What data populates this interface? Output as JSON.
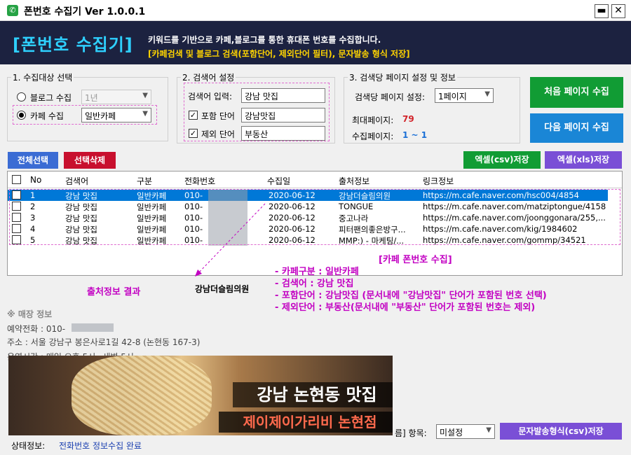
{
  "window": {
    "title": "폰번호 수집기  Ver 1.0.0.1",
    "minimize": "▬",
    "close": "✕"
  },
  "banner": {
    "logo": "[폰번호 수집기]",
    "desc": "키워드를 기반으로 카페,블로그를 통한 휴대폰 번호를 수집합니다.",
    "sub": "[카페검색 및 블로그 검색(포함단어, 제외단어 필터), 문자발송 형식 저장]"
  },
  "target": {
    "label": "1. 수집대상 선택",
    "blog_label": "블로그 수집",
    "blog_value": "1년",
    "cafe_label": "카페 수집",
    "cafe_value": "일반카페"
  },
  "search": {
    "label": "2. 검색어 설정",
    "keyword_label": "검색어 입력:",
    "keyword_value": "강남 맛집",
    "include_label": "포함 단어",
    "include_value": "강남맛집",
    "exclude_label": "제외 단어",
    "exclude_value": "부동산"
  },
  "pages": {
    "label": "3. 검색당 페이지 설정 및 정보",
    "per_search_label": "검색당 페이지 설정:",
    "per_search_value": "1페이지",
    "max_label": "최대페이지:",
    "max_value": "79",
    "collected_label": "수집페이지:",
    "collected_value": "1 ~ 1"
  },
  "buttons": {
    "first_page": "처음 페이지 수집",
    "next_page": "다음 페이지 수집",
    "select_all": "전체선택",
    "delete_selected": "선택삭제",
    "excel_csv": "엑셀(csv)저장",
    "excel_xls": "엑셀(xls)저장",
    "sms_csv": "문자발송형식(csv)저장"
  },
  "table": {
    "headers": [
      "No",
      "검색어",
      "구분",
      "전화번호",
      "수집일",
      "출처정보",
      "링크정보"
    ],
    "rows": [
      {
        "no": "1",
        "keyword": "강남 맛집",
        "type": "일반카페",
        "phone": "010-",
        "date": "2020-06-12",
        "source": "강남더슬림의원",
        "link": "https://m.cafe.naver.com/hsc004/4854"
      },
      {
        "no": "2",
        "keyword": "강남 맛집",
        "type": "일반카페",
        "phone": "010-",
        "date": "2020-06-12",
        "source": "TONGUE",
        "link": "https://m.cafe.naver.com/matziptongue/4158"
      },
      {
        "no": "3",
        "keyword": "강남 맛집",
        "type": "일반카페",
        "phone": "010-",
        "date": "2020-06-12",
        "source": "중고나라",
        "link": "https://m.cafe.naver.com/joonggonara/255,..."
      },
      {
        "no": "4",
        "keyword": "강남 맛집",
        "type": "일반카페",
        "phone": "010-",
        "date": "2020-06-12",
        "source": "피터팬의좋은방구...",
        "link": "https://m.cafe.naver.com/kig/1984602"
      },
      {
        "no": "5",
        "keyword": "강남 맛집",
        "type": "일반카페",
        "phone": "010-",
        "date": "2020-06-12",
        "source": "MMP:) - 마케팅/...",
        "link": "https://m.cafe.naver.com/gommp/34521"
      }
    ]
  },
  "annotation": {
    "title": "[카페 폰번호 수집]",
    "lines": [
      "- 카페구분 : 일반카페",
      "- 검색어 : 강남 맛집",
      "- 포함단어 : 강남맛집 (문서내에 \"강남맛집\" 단어가 포함된 번호 선택)",
      "- 제외단어 : 부동산(문서내에 \"부동산\" 단어가 포함된 번호는 제외)"
    ],
    "source_result": "출처정보 결과",
    "source_name": "강남더슬림의원"
  },
  "store": {
    "heading": "※ 매장 정보",
    "phone": "예약전화 : 010-",
    "address": "주소 : 서울 강남구 봉은사로1길 42-8 (논현동 167-3)",
    "hours": "운영시간 : 매일 오후 5시~새벽 5시",
    "photo_caption1": "강남 논현동 맛집",
    "photo_caption2": "제이제이가리비 논현점"
  },
  "footer": {
    "item_label": "름] 항목:",
    "item_value": "미설정",
    "status_label": "상태정보:",
    "status_value": "전화번호 정보수집 완료"
  },
  "colors": {
    "banner_bg": "#1c2240",
    "logo": "#2ed0ff",
    "sub": "#ffd400",
    "green_btn": "#119c34",
    "blue_btn": "#1a86d6",
    "purple_btn": "#7a4fd6",
    "select_all_btn": "#3b6cd4",
    "delete_btn": "#c8102e",
    "annotation": "#c200c2",
    "status": "#1a3fb0"
  }
}
